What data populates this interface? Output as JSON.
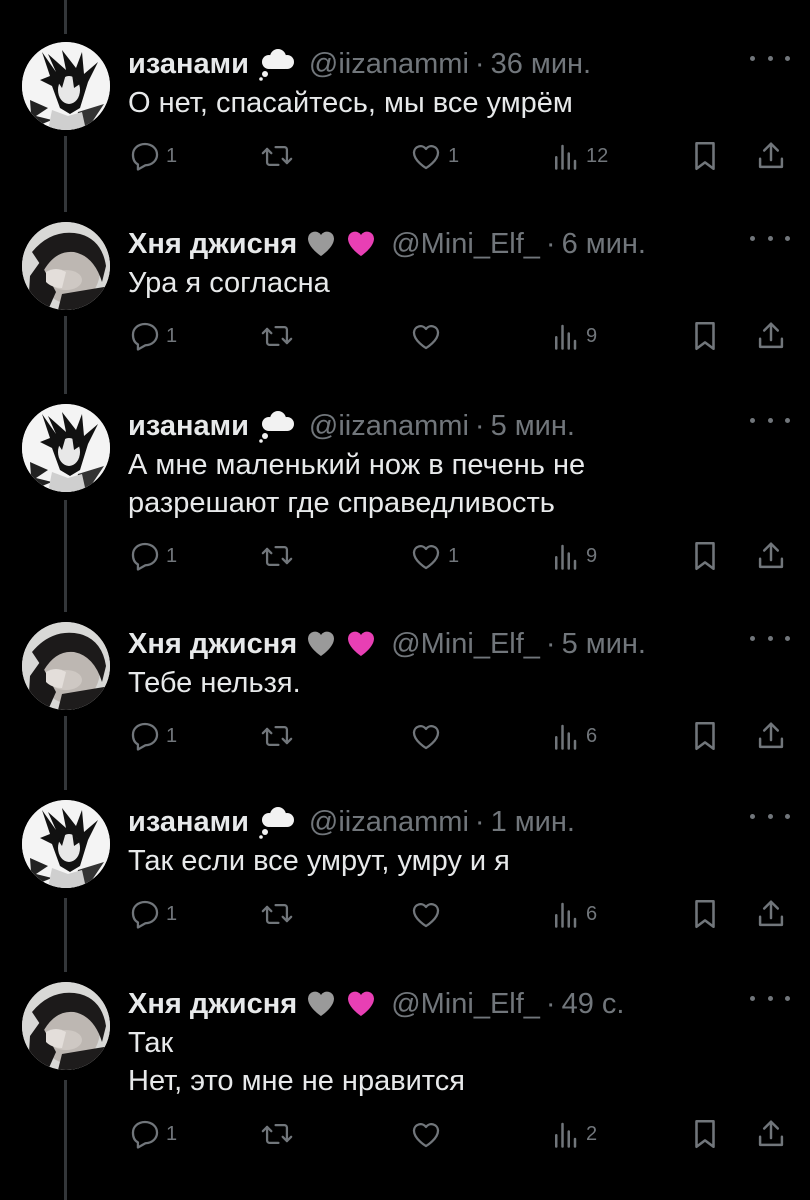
{
  "tweets": [
    {
      "name": "изанами",
      "badge": "cloud-emoji",
      "handle": "@iizanammi",
      "separator": "·",
      "time": "36 мин.",
      "lines": [
        "О нет, спасайтесь, мы все умрём"
      ],
      "replies": "1",
      "retweets": "",
      "likes": "1",
      "views": "12"
    },
    {
      "name": "Хня джисня",
      "badge": "grey-heart-pink-heart-emoji",
      "handle": "@Mini_Elf_",
      "separator": "·",
      "time": "6 мин.",
      "lines": [
        "Ура я согласна"
      ],
      "replies": "1",
      "retweets": "",
      "likes": "",
      "views": "9"
    },
    {
      "name": "изанами",
      "badge": "cloud-emoji",
      "handle": "@iizanammi",
      "separator": "·",
      "time": "5 мин.",
      "lines": [
        "А мне маленький нож в печень не",
        "разрешают где справедливость"
      ],
      "replies": "1",
      "retweets": "",
      "likes": "1",
      "views": "9"
    },
    {
      "name": "Хня джисня",
      "badge": "grey-heart-pink-heart-emoji",
      "handle": "@Mini_Elf_",
      "separator": "·",
      "time": "5 мин.",
      "lines": [
        "Тебе нельзя."
      ],
      "replies": "1",
      "retweets": "",
      "likes": "",
      "views": "6"
    },
    {
      "name": "изанами",
      "badge": "cloud-emoji",
      "handle": "@iizanammi",
      "separator": "·",
      "time": "1 мин.",
      "lines": [
        "Так если все умрут, умру и я"
      ],
      "replies": "1",
      "retweets": "",
      "likes": "",
      "views": "6"
    },
    {
      "name": "Хня джисня",
      "badge": "grey-heart-pink-heart-emoji",
      "handle": "@Mini_Elf_",
      "separator": "·",
      "time": "49 с.",
      "lines": [
        "Так",
        "Нет, это мне не нравится"
      ],
      "replies": "1",
      "retweets": "",
      "likes": "",
      "views": "2"
    }
  ],
  "colors": {
    "background": "#000000",
    "text": "#e7e9ea",
    "muted": "#71767b",
    "thread_line": "#333639",
    "pink_heart": "#e83fb4",
    "grey_heart": "#9a9a9a"
  }
}
